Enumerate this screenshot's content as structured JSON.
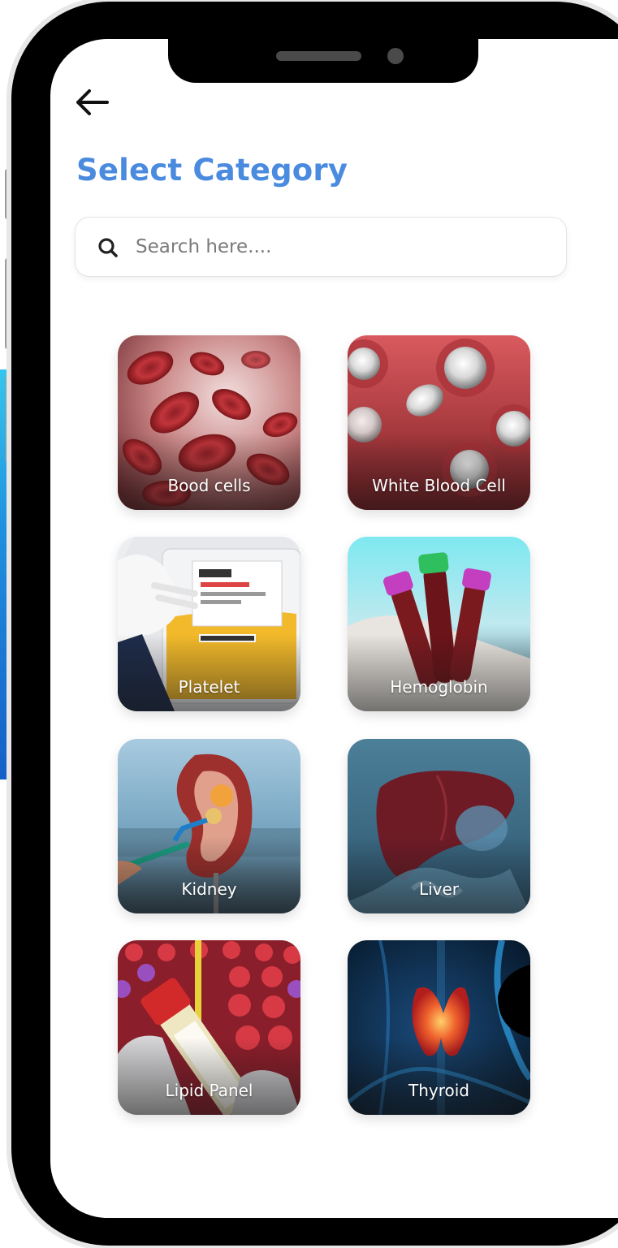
{
  "header": {
    "back_icon": "arrow-left-icon",
    "title": "Select Category"
  },
  "search": {
    "icon": "search-icon",
    "placeholder": "Search here....",
    "value": ""
  },
  "categories": [
    {
      "label": "Bood cells",
      "image": "red-blood-cells"
    },
    {
      "label": "White Blood Cell",
      "image": "white-blood-cells"
    },
    {
      "label": "Platelet",
      "image": "platelet-bag"
    },
    {
      "label": "Hemoglobin",
      "image": "blood-test-tubes"
    },
    {
      "label": "Kidney",
      "image": "kidney-model"
    },
    {
      "label": "Liver",
      "image": "liver-anatomy"
    },
    {
      "label": "Lipid Panel",
      "image": "lipid-profile-tubes"
    },
    {
      "label": "Thyroid",
      "image": "thyroid-anatomy"
    }
  ],
  "colors": {
    "title": "#4a8be0",
    "phone_frame": "#000000",
    "screen": "#ffffff"
  }
}
